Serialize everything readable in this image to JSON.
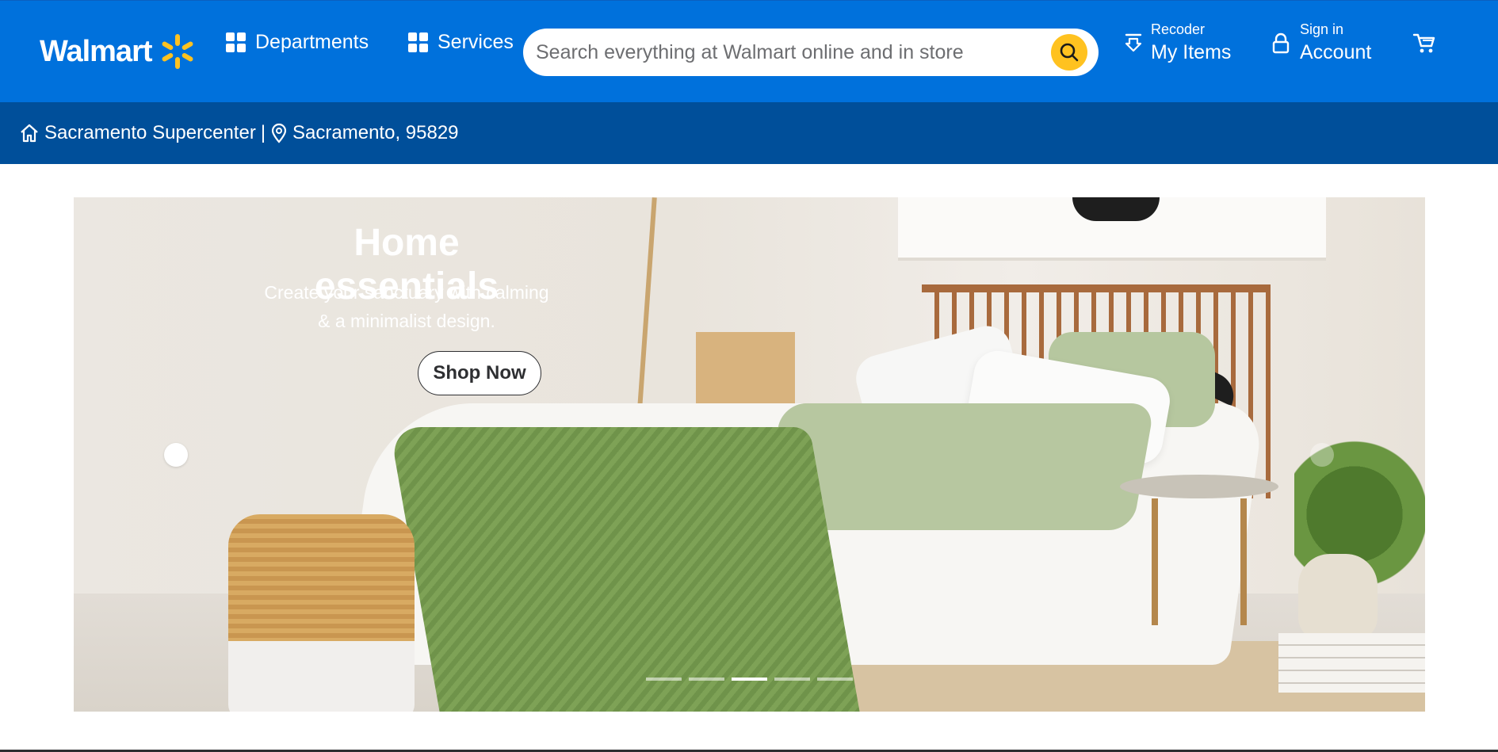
{
  "header": {
    "logo_text": "Walmart",
    "departments_label": "Departments",
    "services_label": "Services",
    "search_placeholder": "Search everything at Walmart online and in store",
    "reorder_small": "Recoder",
    "reorder_big": "My Items",
    "account_small": "Sign in",
    "account_big": "Account",
    "brand_color": "#0071dc",
    "spark_color": "#ffc220"
  },
  "store_bar": {
    "store_name": "Sacramento Supercenter",
    "separator": "|",
    "location": "Sacramento, 95829",
    "background": "#004f9a"
  },
  "hero": {
    "title": "Home essentials",
    "subtitle": "Create your sanctuary with calming & a minimalist design.",
    "cta_label": "Shop Now",
    "slide_count": 5,
    "active_slide": 3
  }
}
